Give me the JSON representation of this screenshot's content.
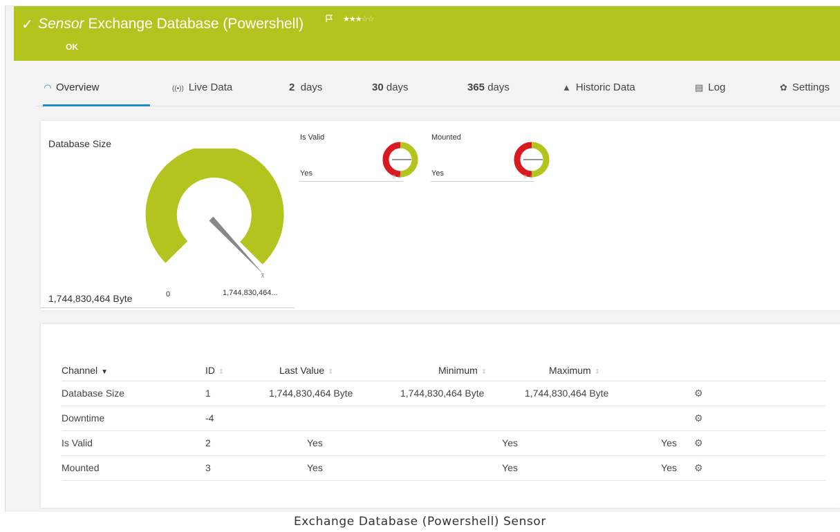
{
  "header": {
    "sensor_type": "Sensor",
    "sensor_name": "Exchange Database (Powershell)",
    "status": "OK",
    "priority_filled": "★★★",
    "priority_empty": "☆☆",
    "priority": 3,
    "priority_max": 5,
    "accent_color": "#b4c41f"
  },
  "tabs": [
    {
      "icon": "gauge-icon",
      "glyph": "◠",
      "label": "Overview",
      "active": true
    },
    {
      "icon": "live-data-icon",
      "glyph": "((•))",
      "label": "Live Data"
    },
    {
      "num": "2",
      "label": "days"
    },
    {
      "num": "30",
      "label": "days"
    },
    {
      "num": "365",
      "label": "days"
    },
    {
      "icon": "area-chart-icon",
      "glyph": "▲",
      "label": "Historic Data"
    },
    {
      "icon": "log-icon",
      "glyph": "▤",
      "label": "Log"
    },
    {
      "icon": "gear-icon",
      "glyph": "✿",
      "label": "Settings"
    }
  ],
  "gauges": {
    "main": {
      "title": "Database Size",
      "value": "1,744,830,464 Byte",
      "min_label": "0",
      "max_label": "1,744,830,464...",
      "fraction": 1.0
    },
    "is_valid": {
      "title": "Is Valid",
      "value": "Yes"
    },
    "mounted": {
      "title": "Mounted",
      "value": "Yes"
    }
  },
  "channels_table": {
    "headers": {
      "channel": "Channel",
      "id": "ID",
      "last_value": "Last Value",
      "minimum": "Minimum",
      "maximum": "Maximum"
    },
    "rows": [
      {
        "channel": "Database Size",
        "id": "1",
        "last": "1,744,830,464 Byte",
        "min": "1,744,830,464 Byte",
        "max": "1,744,830,464 Byte"
      },
      {
        "channel": "Downtime",
        "id": "-4",
        "last": "",
        "min": "",
        "max": ""
      },
      {
        "channel": "Is Valid",
        "id": "2",
        "last": "Yes",
        "min": "Yes",
        "max": "Yes"
      },
      {
        "channel": "Mounted",
        "id": "3",
        "last": "Yes",
        "min": "Yes",
        "max": "Yes"
      }
    ]
  },
  "caption": "Exchange Database (Powershell) Sensor",
  "colors": {
    "ok": "#b4c41f",
    "error": "#d71920",
    "tab_active": "#1a8ccc"
  }
}
